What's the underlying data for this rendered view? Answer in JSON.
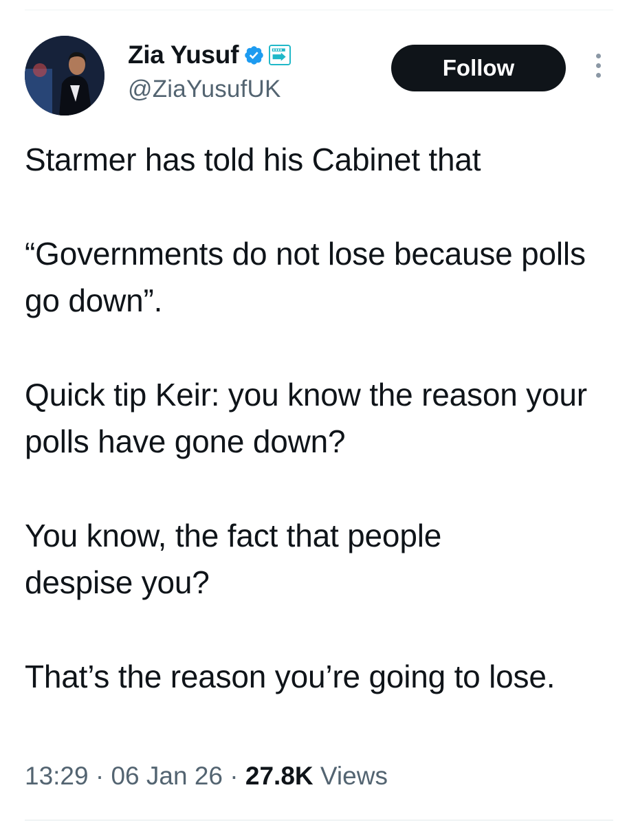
{
  "author": {
    "display_name": "Zia Yusuf",
    "handle": "@ZiaYusufUK",
    "verified_icon": "verified-badge-icon",
    "affiliation_icon": "reform-uk-badge-icon",
    "affiliation_text": "REFORM UK"
  },
  "actions": {
    "follow_label": "Follow",
    "more_icon": "more-options-icon"
  },
  "tweet": {
    "paragraphs": [
      "Starmer has told his Cabinet that",
      "“Governments do not lose because polls go down”.",
      "Quick tip Keir: you know the reason your polls have gone down?",
      "You know, the fact that people despise you?",
      "That’s the reason you’re going to lose."
    ]
  },
  "meta": {
    "time": "13:29",
    "separator": "·",
    "date": "06 Jan 26",
    "views_count": "27.8K",
    "views_label": "Views"
  },
  "colors": {
    "text": "#0f1419",
    "secondary": "#536471",
    "verified": "#1d9bf0",
    "button_bg": "#0f1419",
    "affiliation": "#20b8c8"
  }
}
